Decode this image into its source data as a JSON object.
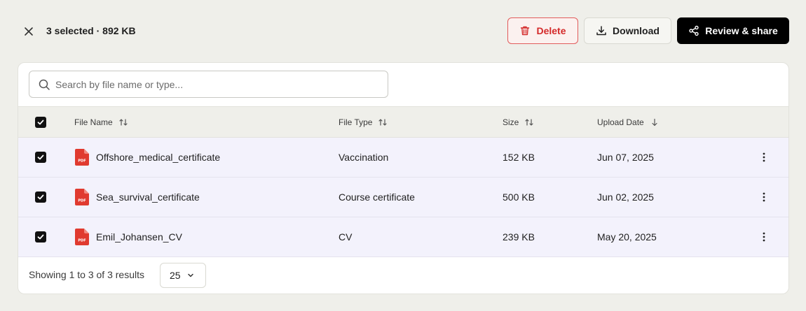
{
  "selection": {
    "info": "3 selected · 892 KB"
  },
  "toolbar": {
    "delete_label": "Delete",
    "download_label": "Download",
    "share_label": "Review & share"
  },
  "search": {
    "placeholder": "Search by file name or type...",
    "value": ""
  },
  "table": {
    "headers": {
      "file_name": "File Name",
      "file_type": "File Type",
      "size": "Size",
      "upload_date": "Upload Date"
    },
    "rows": [
      {
        "name": "Offshore_medical_certificate",
        "type": "Vaccination",
        "size": "152 KB",
        "date": "Jun 07, 2025",
        "icon_text": "PDF"
      },
      {
        "name": "Sea_survival_certificate",
        "type": "Course certificate",
        "size": "500 KB",
        "date": "Jun 02, 2025",
        "icon_text": "PDF"
      },
      {
        "name": "Emil_Johansen_CV",
        "type": "CV",
        "size": "239 KB",
        "date": "May 20, 2025",
        "icon_text": "PDF"
      }
    ]
  },
  "footer": {
    "results_text": "Showing 1 to 3 of 3 results",
    "page_size": "25"
  },
  "colors": {
    "accent_danger": "#d42a2a",
    "pdf_red": "#e03a2f",
    "selected_row_bg": "#f3f2fc",
    "page_bg": "#efefea"
  },
  "icons": {
    "close": "close-icon",
    "delete": "trash-icon",
    "download": "download-icon",
    "share": "share-icon",
    "search": "search-icon",
    "sort": "sort-arrows-icon",
    "sort_desc": "arrow-down-icon",
    "file": "pdf-file-icon",
    "row_menu": "kebab-menu-icon",
    "dropdown": "chevron-down-icon"
  }
}
